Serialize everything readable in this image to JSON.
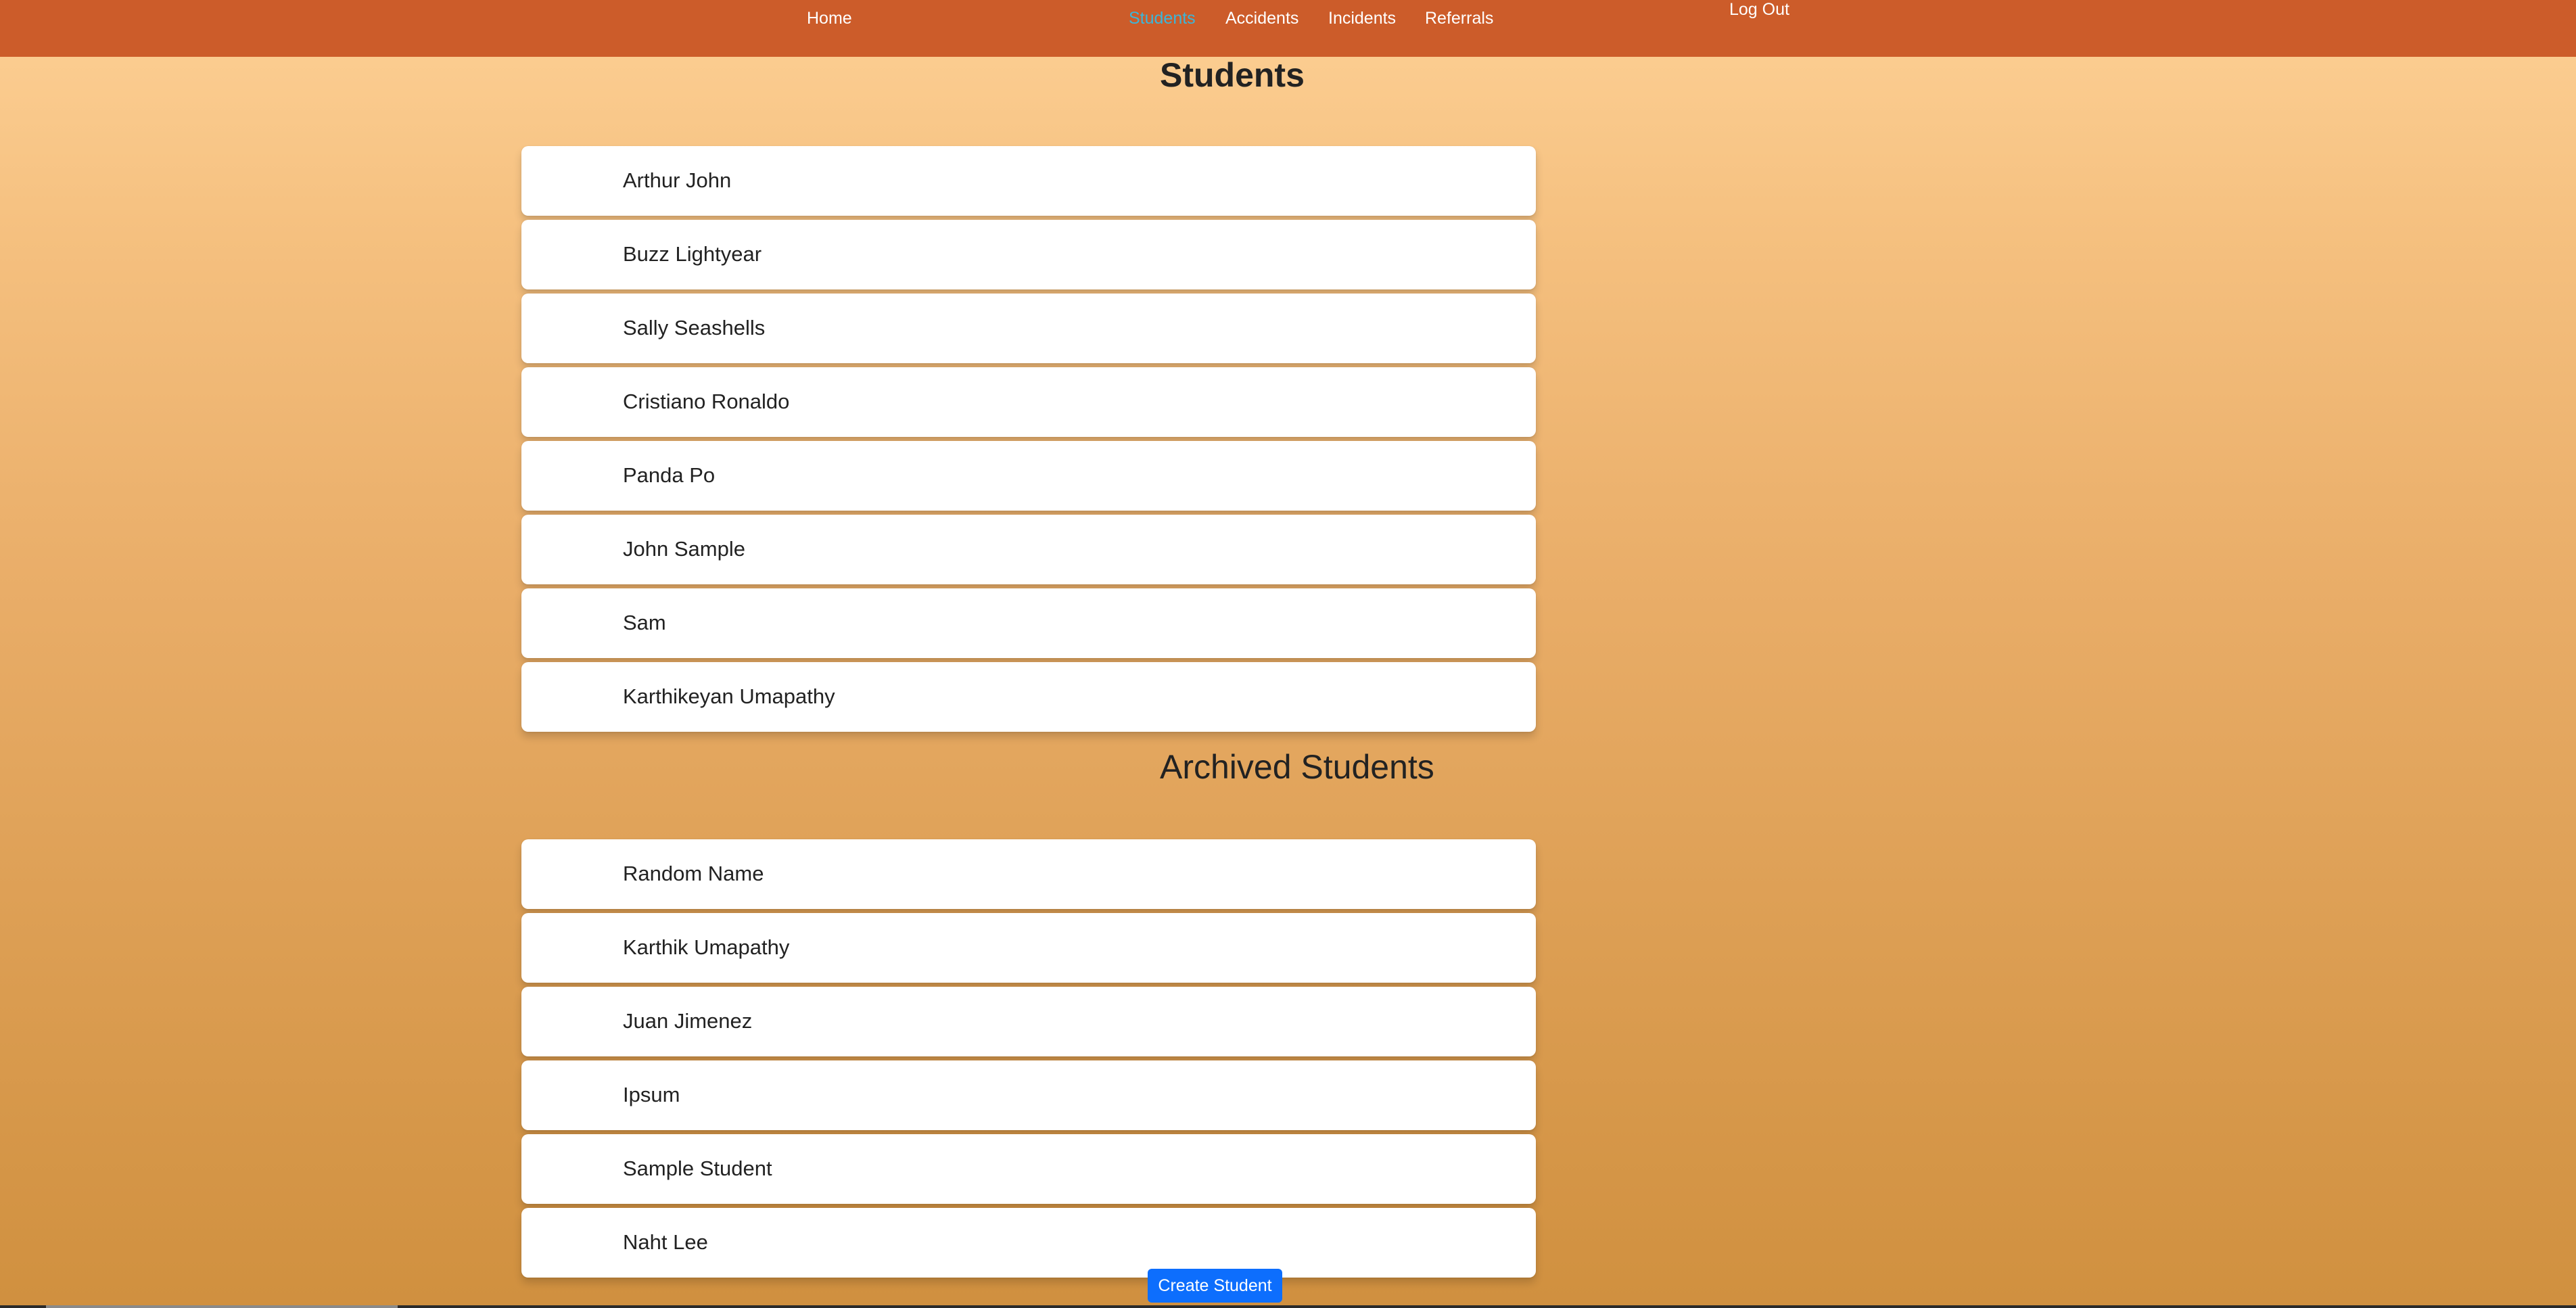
{
  "nav": {
    "home": "Home",
    "students": "Students",
    "accidents": "Accidents",
    "incidents": "Incidents",
    "referrals": "Referrals",
    "logout": "Log Out"
  },
  "students_section": {
    "title": "Students",
    "items": [
      {
        "name": "Arthur John"
      },
      {
        "name": "Buzz Lightyear"
      },
      {
        "name": "Sally Seashells"
      },
      {
        "name": "Cristiano Ronaldo"
      },
      {
        "name": "Panda Po"
      },
      {
        "name": "John Sample"
      },
      {
        "name": "Sam"
      },
      {
        "name": "Karthikeyan Umapathy"
      }
    ]
  },
  "archived_section": {
    "title": "Archived Students",
    "items": [
      {
        "name": "Random Name"
      },
      {
        "name": "Karthik Umapathy"
      },
      {
        "name": "Juan Jimenez"
      },
      {
        "name": "Ipsum"
      },
      {
        "name": "Sample Student"
      },
      {
        "name": "Naht Lee"
      }
    ]
  },
  "actions": {
    "create_student": "Create Student"
  },
  "colors": {
    "navbar": "#cc5c2a",
    "active_link": "#3bb6d9",
    "primary_button": "#0d6efd",
    "background_top": "#fdd095",
    "background_bottom": "#d0903f"
  }
}
